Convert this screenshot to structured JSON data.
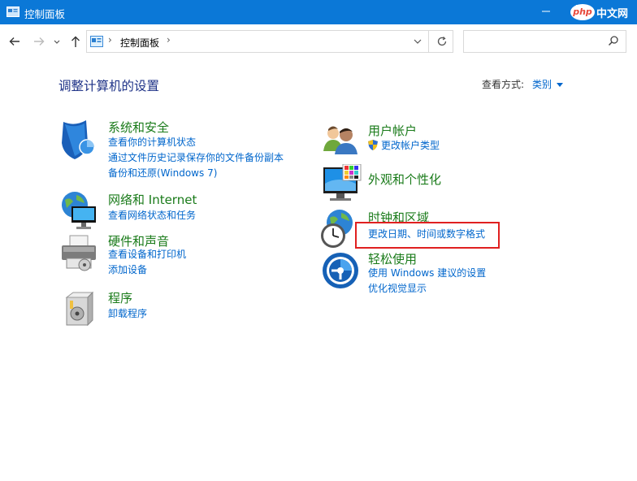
{
  "window": {
    "title": "控制面板"
  },
  "watermark": {
    "badge": "php",
    "text": "中文网"
  },
  "address": {
    "crumb": "控制面板",
    "separator": "›"
  },
  "search": {
    "placeholder": ""
  },
  "page": {
    "heading": "调整计算机的设置",
    "view_by_label": "查看方式:",
    "view_by_value": "类别"
  },
  "categories": {
    "security": {
      "title": "系统和安全",
      "links": [
        "查看你的计算机状态",
        "通过文件历史记录保存你的文件备份副本",
        "备份和还原(Windows 7)"
      ]
    },
    "network": {
      "title": "网络和 Internet",
      "links": [
        "查看网络状态和任务"
      ]
    },
    "hardware": {
      "title": "硬件和声音",
      "links": [
        "查看设备和打印机",
        "添加设备"
      ]
    },
    "programs": {
      "title": "程序",
      "links": [
        "卸载程序"
      ]
    },
    "accounts": {
      "title": "用户帐户",
      "links": [
        "更改帐户类型"
      ]
    },
    "appearance": {
      "title": "外观和个性化",
      "links": []
    },
    "clock": {
      "title": "时钟和区域",
      "links": [
        "更改日期、时间或数字格式"
      ]
    },
    "ease": {
      "title": "轻松使用",
      "links": [
        "使用 Windows 建议的设置",
        "优化视觉显示"
      ]
    }
  },
  "colors": {
    "titlebar": "#0b78d7",
    "category_title": "#1a7b1a",
    "link": "#0066cc",
    "heading": "#1e3287",
    "highlight": "#e02020"
  },
  "icons": [
    "back-arrow-icon",
    "forward-arrow-icon",
    "recent-dropdown-icon",
    "up-arrow-icon",
    "refresh-icon",
    "search-icon",
    "shield-icon",
    "globe-network-icon",
    "printer-icon",
    "programs-box-icon",
    "users-icon",
    "monitor-palette-icon",
    "clock-globe-icon",
    "ease-access-icon"
  ]
}
